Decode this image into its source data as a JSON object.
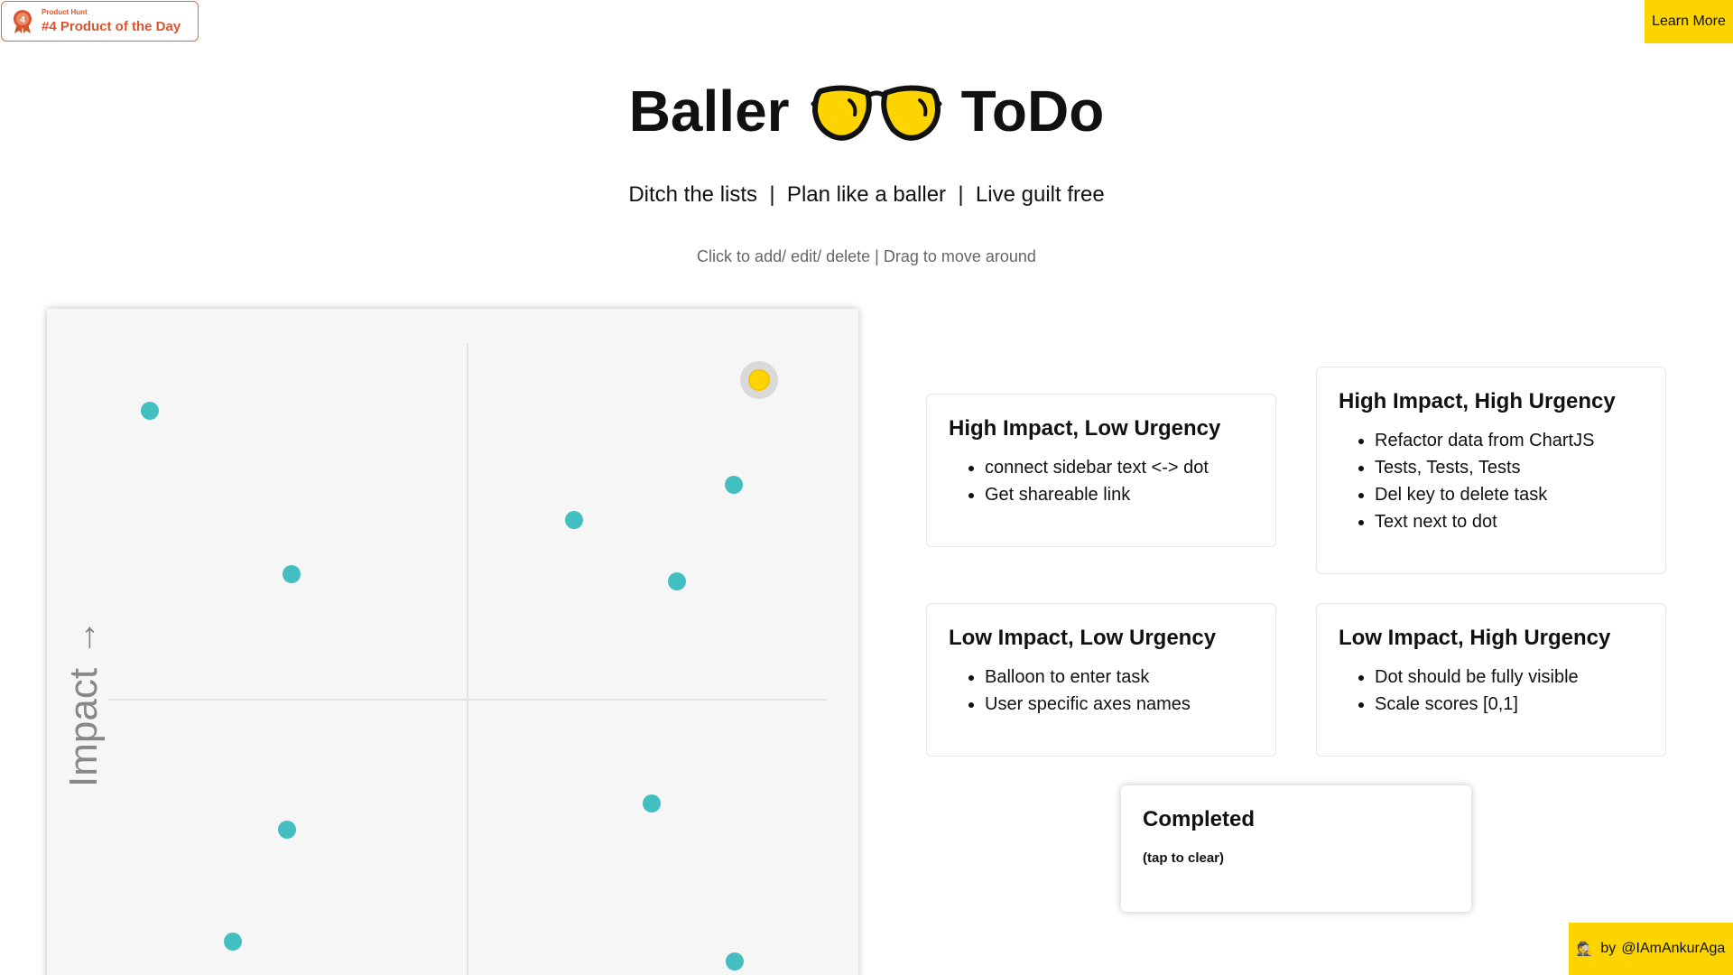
{
  "badge": {
    "small": "Product Hunt",
    "big": "#4 Product of the Day",
    "color": "#da552f"
  },
  "learn_more": "Learn More",
  "title": {
    "left": "Baller",
    "right": "ToDo",
    "icon": "sunglasses-icon"
  },
  "subtitle": "Ditch the lists  |  Plan like a baller  |  Live guilt free",
  "hint": "Click to add/ edit/ delete | Drag to move around",
  "matrix": {
    "y_axis_label": "Impact",
    "y_axis_arrow": "→",
    "dot_color": "#43bfc1",
    "active_dot_color": "#fcd500"
  },
  "quadrants": {
    "high_impact_low_urgency": {
      "title": "High Impact, Low Urgency",
      "items": [
        "connect sidebar text <-> dot",
        "Get shareable link"
      ]
    },
    "high_impact_high_urgency": {
      "title": "High Impact, High Urgency",
      "items": [
        "Refactor data from ChartJS",
        "Tests, Tests, Tests",
        "Del key to delete task",
        "Text next to dot"
      ]
    },
    "low_impact_low_urgency": {
      "title": "Low Impact, Low Urgency",
      "items": [
        "Balloon to enter task",
        "User specific axes names"
      ]
    },
    "low_impact_high_urgency": {
      "title": "Low Impact, High Urgency",
      "items": [
        "Dot should be fully visible",
        "Scale scores [0,1]"
      ]
    }
  },
  "completed": {
    "title": "Completed",
    "subtitle": "(tap to clear)"
  },
  "author": {
    "prefix": "by",
    "handle": "@IAmAnkurAga",
    "emoji": "🕵"
  }
}
